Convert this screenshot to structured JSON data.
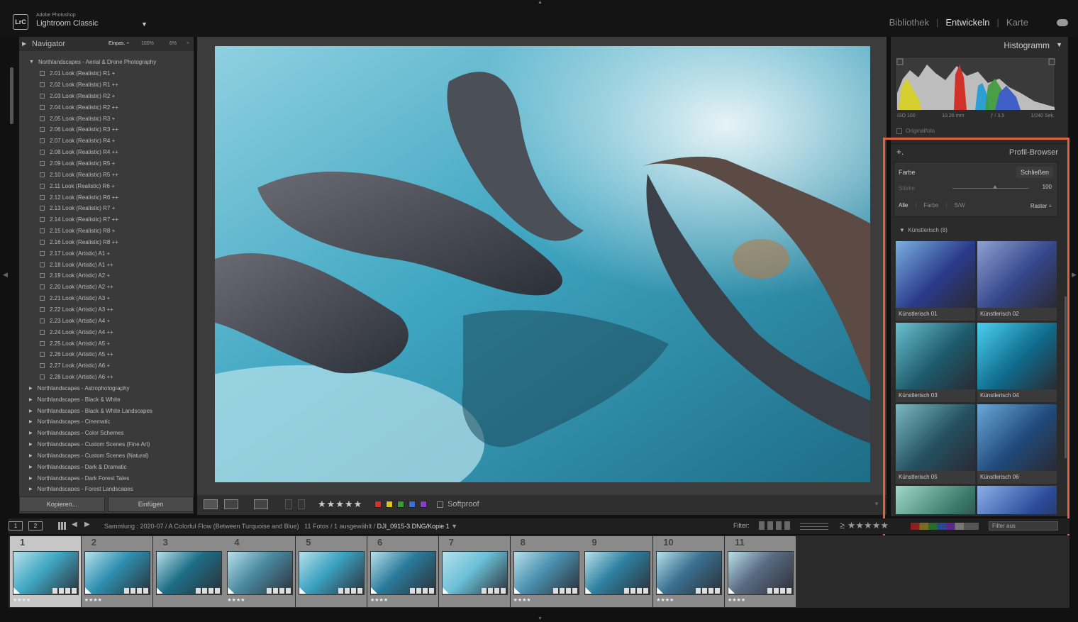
{
  "app": {
    "vendor": "Adobe Photoshop",
    "name": "Lightroom Classic",
    "logo_text": "LrC",
    "caret": "▼",
    "modules": [
      "Bibliothek",
      "Entwickeln",
      "Karte"
    ],
    "active_module": "Entwickeln"
  },
  "navigator": {
    "title": "Navigator",
    "zoom_fit": "Einpas. ÷",
    "zoom_100": "100%",
    "zoom_6": "6%",
    "zoom_more": "÷"
  },
  "presets": {
    "open_folder": "Northlandscapes - Aerial & Drone Photography",
    "items": [
      "2.01 Look (Realistic) R1 +",
      "2.02 Look (Realistic) R1 ++",
      "2.03 Look (Realistic) R2 +",
      "2.04 Look (Realistic) R2 ++",
      "2.05 Look (Realistic) R3 +",
      "2.06 Look (Realistic) R3 ++",
      "2.07 Look (Realistic) R4 +",
      "2.08 Look (Realistic) R4 ++",
      "2.09 Look (Realistic) R5 +",
      "2.10 Look (Realistic) R5 ++",
      "2.11 Look (Realistic) R6 +",
      "2.12 Look (Realistic) R6 ++",
      "2.13 Look (Realistic) R7 +",
      "2.14 Look (Realistic) R7 ++",
      "2.15 Look (Realistic) R8 +",
      "2.16 Look (Realistic) R8 ++",
      "2.17 Look (Artistic) A1 +",
      "2.18 Look (Artistic) A1 ++",
      "2.19 Look (Artistic) A2 +",
      "2.20 Look (Artistic) A2 ++",
      "2.21 Look (Artistic) A3 +",
      "2.22 Look (Artistic) A3 ++",
      "2.23 Look (Artistic) A4 +",
      "2.24 Look (Artistic) A4 ++",
      "2.25 Look (Artistic) A5 +",
      "2.26 Look (Artistic) A5 ++",
      "2.27 Look (Artistic) A6 +",
      "2.28 Look (Artistic) A6 ++"
    ],
    "folders": [
      "Northlandscapes - Astrophotography",
      "Northlandscapes - Black & White",
      "Northlandscapes - Black & White Landscapes",
      "Northlandscapes - Cinematic",
      "Northlandscapes - Color Schemes",
      "Northlandscapes - Custom Scenes (Fine Art)",
      "Northlandscapes - Custom Scenes (Natural)",
      "Northlandscapes - Dark & Dramatic",
      "Northlandscapes - Dark Forest Tales",
      "Northlandscapes - Forest Landscapes"
    ]
  },
  "left_buttons": {
    "copy": "Kopieren...",
    "paste": "Einfügen"
  },
  "toolbar": {
    "stars": "★★★★★",
    "rating": 4,
    "color_labels": [
      "#d0322d",
      "#d8c41f",
      "#3c9a3a",
      "#3a6fd8",
      "#8a3fc8"
    ],
    "softproof": "Softproof"
  },
  "histogram": {
    "title": "Histogramm",
    "iso": "ISO 100",
    "focal": "10,26 mm",
    "aperture": "ƒ / 3,5",
    "shutter": "1/240 Sek.",
    "original": "Originalfoto"
  },
  "profile_browser": {
    "title": "Profil-Browser",
    "plus": "+.",
    "type": "Farbe",
    "close": "Schließen",
    "amount_label": "Stärke",
    "amount_value": "100",
    "amount": 100,
    "tabs": [
      "Alle",
      "Farbe",
      "S/W"
    ],
    "active_tab": "Alle",
    "view": "Raster ÷",
    "group": "Künstlerisch (8)",
    "profiles": [
      "Künstlerisch 01",
      "Künstlerisch 02",
      "Künstlerisch 03",
      "Künstlerisch 04",
      "Künstlerisch 05",
      "Künstlerisch 06",
      "",
      ""
    ]
  },
  "filmstrip_bar": {
    "view1": "1",
    "view2": "2",
    "collection_prefix": "Sammlung : 2020-07 / A Colorful Flow (Between Turquoise and Blue)",
    "count": "11 Fotos / 1 ausgewählt /",
    "filename": "DJI_0915-3.DNG/Kopie 1",
    "filter_label": "Filter:",
    "filter_stars": "≥ ★★★★★",
    "filter_off": "Filter aus"
  },
  "filmstrip": {
    "frames": [
      {
        "n": "1",
        "stars": "★★★★",
        "selected": true
      },
      {
        "n": "2",
        "stars": "★★★★"
      },
      {
        "n": "3",
        "stars": ""
      },
      {
        "n": "4",
        "stars": "★★★★"
      },
      {
        "n": "5",
        "stars": ""
      },
      {
        "n": "6",
        "stars": "★★★★"
      },
      {
        "n": "7",
        "stars": ""
      },
      {
        "n": "8",
        "stars": "★★★★"
      },
      {
        "n": "9",
        "stars": ""
      },
      {
        "n": "10",
        "stars": "★★★★"
      },
      {
        "n": "11",
        "stars": "★★★★"
      }
    ]
  }
}
